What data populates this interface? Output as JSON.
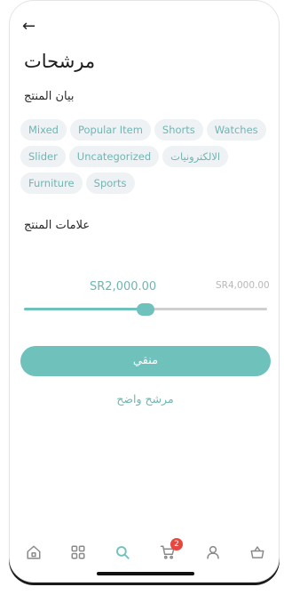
{
  "header": {
    "back_icon": "arrow-left-icon",
    "back_glyph": "←",
    "title": "مرشحات"
  },
  "categories_section": {
    "label": "بيان المنتج",
    "chips": [
      "Mixed",
      "Popular Item",
      "Shorts",
      "Watches",
      "Slider",
      "Uncategorized",
      "الالكترونيات",
      "Furniture",
      "Sports"
    ]
  },
  "tags_section": {
    "label": "علامات المنتج"
  },
  "price": {
    "min_label": "SR2,000.00",
    "max_label": "SR4,000.00",
    "range_fraction": 0.5
  },
  "actions": {
    "apply_label": "منقي",
    "clear_label": "مرشح واضح"
  },
  "tabbar": {
    "items": [
      "home-icon",
      "grid-icon",
      "search-icon",
      "cart-icon",
      "user-icon",
      "basket-icon"
    ],
    "cart_badge": "2",
    "active": "search-icon"
  },
  "colors": {
    "accent": "#6fc1bc",
    "chip_bg": "#eef2f4",
    "badge": "#e9463e"
  }
}
